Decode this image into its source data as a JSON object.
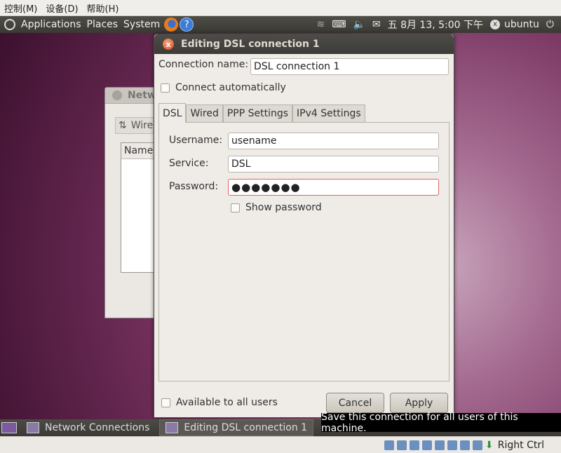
{
  "vbox_menu": [
    "控制(M)",
    "设备(D)",
    "帮助(H)"
  ],
  "top_panel": {
    "menus": [
      "Applications",
      "Places",
      "System"
    ],
    "help_glyph": "?",
    "clock": "五 8月 13, 5:00 下午",
    "user": "ubuntu"
  },
  "background_window": {
    "title_fragment": "Netw",
    "tab_fragment": "Wire",
    "column_fragment": "Name"
  },
  "dialog": {
    "title": "Editing DSL connection 1",
    "close_glyph": "x",
    "connection_name_label": "Connection name:",
    "connection_name_value": "DSL connection 1",
    "connect_auto_label": "Connect automatically",
    "tabs": [
      "DSL",
      "Wired",
      "PPP Settings",
      "IPv4 Settings"
    ],
    "username_label": "Username:",
    "username_value": "usename",
    "service_label": "Service:",
    "service_value": "DSL",
    "password_label": "Password:",
    "password_value": "●●●●●●●",
    "show_password_label": "Show password",
    "available_all_label": "Available to all users",
    "cancel_label": "Cancel",
    "apply_label": "Apply"
  },
  "taskbar": {
    "items": [
      "Network Connections",
      "Editing DSL connection 1"
    ]
  },
  "tooltip": "Save this connection for all users of this machine.",
  "vbox_status": {
    "host_key": "Right Ctrl"
  },
  "colors": {
    "desktop": "#74305c",
    "panel": "#3c3b37",
    "close_button": "#df4a22",
    "password_border": "#e06464"
  }
}
